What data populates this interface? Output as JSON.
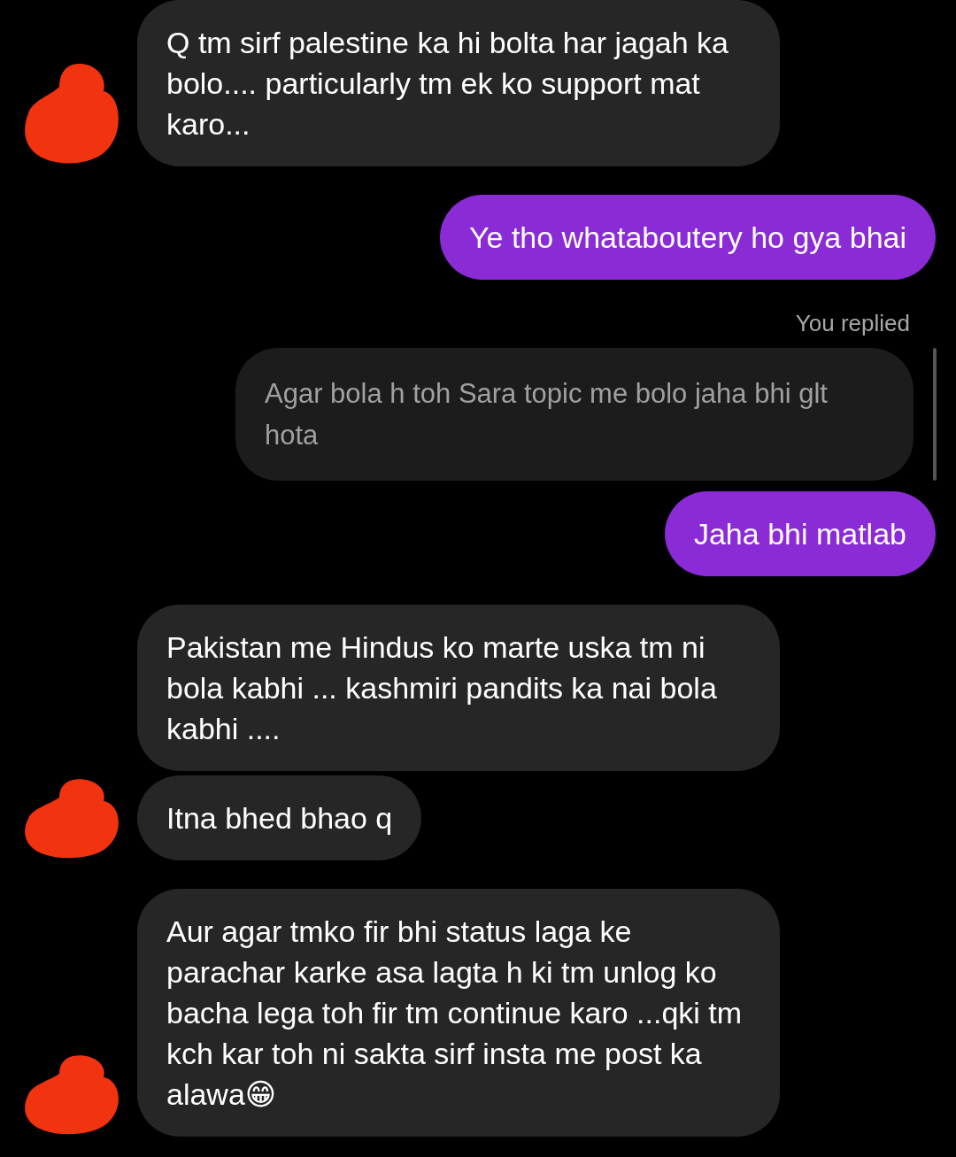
{
  "messages": [
    {
      "kind": "incoming",
      "text": "Q tm sirf palestine ka hi bolta har jagah ka bolo.... particularly tm ek ko support mat karo...",
      "avatar": true
    },
    {
      "kind": "outgoing",
      "text": "Ye tho whataboutery ho gya bhai"
    },
    {
      "kind": "reply_label",
      "text": "You replied"
    },
    {
      "kind": "quoted",
      "text": "Agar bola h toh Sara topic me bolo jaha bhi glt hota"
    },
    {
      "kind": "outgoing",
      "text": "Jaha bhi matlab"
    },
    {
      "kind": "incoming",
      "text": "Pakistan me Hindus ko marte uska tm ni bola kabhi ... kashmiri pandits ka nai bola kabhi ....",
      "avatar": false
    },
    {
      "kind": "incoming",
      "text": "Itna bhed bhao q",
      "avatar": true
    },
    {
      "kind": "incoming",
      "text": "Aur agar tmko fir bhi status laga ke parachar karke asa lagta h ki tm unlog ko bacha lega toh fir tm continue karo ...qki tm kch kar toh ni sakta sirf insta me post ka alawa😁",
      "avatar": true
    }
  ]
}
